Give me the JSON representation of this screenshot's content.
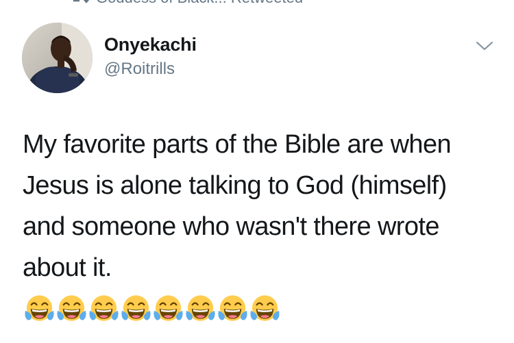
{
  "retweet_bar": {
    "icon": "retweet-icon",
    "text": "Goddess of Black... Retweeted"
  },
  "author": {
    "avatar": "avatar",
    "display_name": "Onyekachi",
    "handle": "@Roitrills"
  },
  "menu": {
    "icon": "chevron-down-icon"
  },
  "tweet": {
    "lines": [
      "My favorite parts of the Bible are when",
      "Jesus is alone talking to God (himself)",
      "and someone who wasn't there wrote",
      "about it."
    ],
    "emoji": [
      "😂",
      "😂",
      "😂",
      "😂",
      "😂",
      "😂",
      "😂",
      "😂"
    ],
    "emoji_icon": "face-with-tears-of-joy-icon"
  },
  "colors": {
    "text_primary": "#14171a",
    "text_secondary": "#657786",
    "background": "#ffffff",
    "emoji_face": "#ffcc4d",
    "emoji_tear": "#5dadec"
  }
}
